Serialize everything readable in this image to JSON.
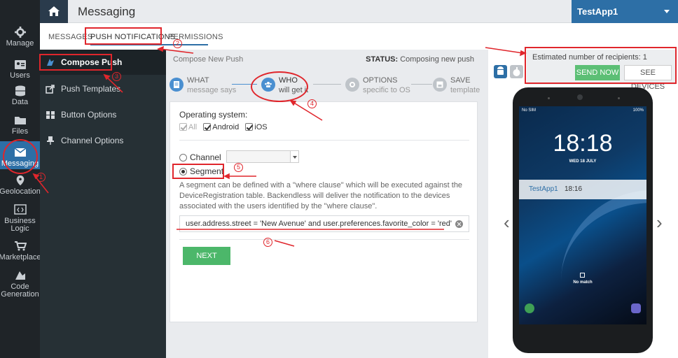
{
  "topbar": {
    "title": "Messaging",
    "app_name": "TestApp1"
  },
  "rail": {
    "items": [
      {
        "label": "Manage",
        "icon": "gear-icon"
      },
      {
        "label": "Users",
        "icon": "users-icon"
      },
      {
        "label": "Data",
        "icon": "database-icon"
      },
      {
        "label": "Files",
        "icon": "folder-icon"
      },
      {
        "label": "Messaging",
        "icon": "envelope-icon",
        "active": true
      },
      {
        "label": "Geolocation",
        "icon": "map-pin-icon"
      },
      {
        "label": "Business Logic",
        "label_line1": "Business",
        "label_line2": "Logic",
        "icon": "code-icon"
      },
      {
        "label": "Marketplace",
        "icon": "cart-icon"
      },
      {
        "label": "Code Generation",
        "label_line1": "Code",
        "label_line2": "Generation",
        "icon": "codegen-icon"
      }
    ]
  },
  "tabs": [
    {
      "label": "MESSAGES"
    },
    {
      "label": "PUSH NOTIFICATIONS",
      "active": true
    },
    {
      "label": "PERMISSIONS"
    }
  ],
  "sidemenu": {
    "items": [
      {
        "label": "Compose Push",
        "icon": "compose-icon",
        "active": true
      },
      {
        "label": "Push Templates",
        "icon": "share-icon"
      },
      {
        "label": "Button Options",
        "icon": "grid-icon"
      },
      {
        "label": "Channel Options",
        "icon": "pin-icon"
      }
    ]
  },
  "compose": {
    "header": "Compose New Push",
    "status_label": "STATUS:",
    "status_value": "Composing new push",
    "steps": [
      {
        "title": "WHAT",
        "subtitle": "message says"
      },
      {
        "title": "WHO",
        "subtitle": "will get it"
      },
      {
        "title": "OPTIONS",
        "subtitle": "specific to OS"
      },
      {
        "title": "SAVE",
        "subtitle": "template"
      }
    ],
    "os_label": "Operating system:",
    "os_options": [
      {
        "label": "All",
        "checked": true,
        "disabled": true
      },
      {
        "label": "Android",
        "checked": true
      },
      {
        "label": "iOS",
        "checked": true
      }
    ],
    "channel_label": "Channel",
    "segment_label": "Segment",
    "segment_description": "A segment can be defined with a \"where clause\" which will be executed against the DeviceRegistration table. Backendless will deliver the notification to the devices associated with the users identified by the \"where clause\".",
    "where_clause": "user.address.street = 'New Avenue' and user.preferences.favorite_color = 'red'",
    "next_label": "NEXT"
  },
  "preview": {
    "recipients_text": "Estimated number of recipients: 1",
    "send_now_label": "SEND NOW",
    "see_devices_label": "SEE DEVICES",
    "phone": {
      "status_left": "No SIM",
      "status_right": "100%",
      "time": "18:18",
      "date": "WED 18 JULY",
      "notif_app": "TestApp1",
      "notif_time": "18:16",
      "no_match": "No match"
    }
  },
  "annotations": [
    "1",
    "2",
    "3",
    "4",
    "5",
    "6"
  ],
  "colors": {
    "accent": "#2d6fa6",
    "annotation": "#e0262c",
    "success": "#4cb76a"
  }
}
